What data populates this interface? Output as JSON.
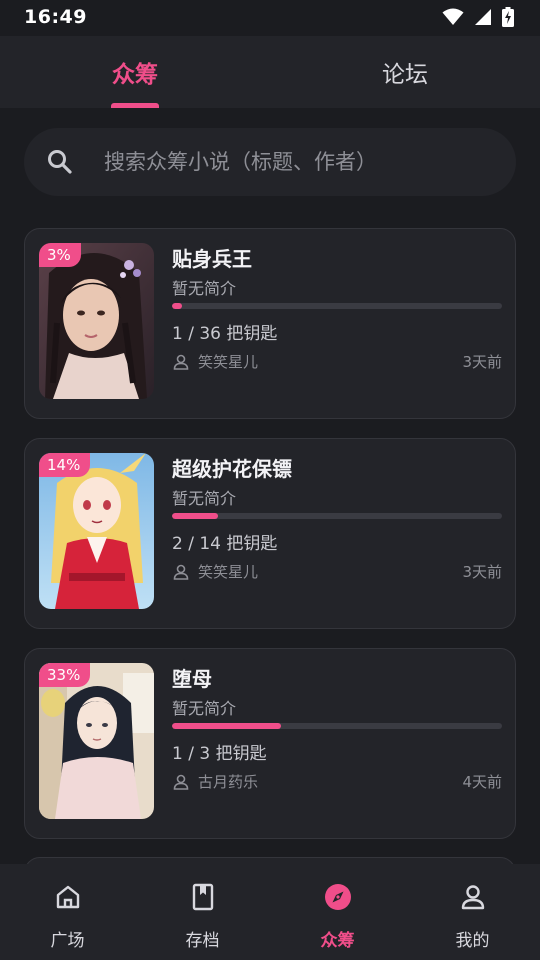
{
  "status_bar": {
    "time": "16:49"
  },
  "top_tabs": [
    {
      "label": "众筹",
      "active": true
    },
    {
      "label": "论坛",
      "active": false
    }
  ],
  "search": {
    "placeholder": "搜索众筹小说（标题、作者）",
    "value": ""
  },
  "cards": [
    {
      "title": "贴身兵王",
      "description": "暂无简介",
      "percent_label": "3%",
      "progress": 0.03,
      "keys": "1 / 36 把钥匙",
      "author": "笑笑星儿",
      "time": "3天前"
    },
    {
      "title": "超级护花保镖",
      "description": "暂无简介",
      "percent_label": "14%",
      "progress": 0.14,
      "keys": "2 / 14 把钥匙",
      "author": "笑笑星儿",
      "time": "3天前"
    },
    {
      "title": "堕母",
      "description": "暂无简介",
      "percent_label": "33%",
      "progress": 0.33,
      "keys": "1 / 3 把钥匙",
      "author": "古月药乐",
      "time": "4天前"
    }
  ],
  "bottom_nav": [
    {
      "label": "广场",
      "icon": "home-icon",
      "active": false
    },
    {
      "label": "存档",
      "icon": "bookmark-book-icon",
      "active": false
    },
    {
      "label": "众筹",
      "icon": "compass-icon",
      "active": true
    },
    {
      "label": "我的",
      "icon": "person-icon",
      "active": false
    }
  ],
  "colors": {
    "accent": "#f04e8a",
    "background": "#1b1c20",
    "surface": "#232429",
    "text_secondary": "#8e8f96"
  }
}
